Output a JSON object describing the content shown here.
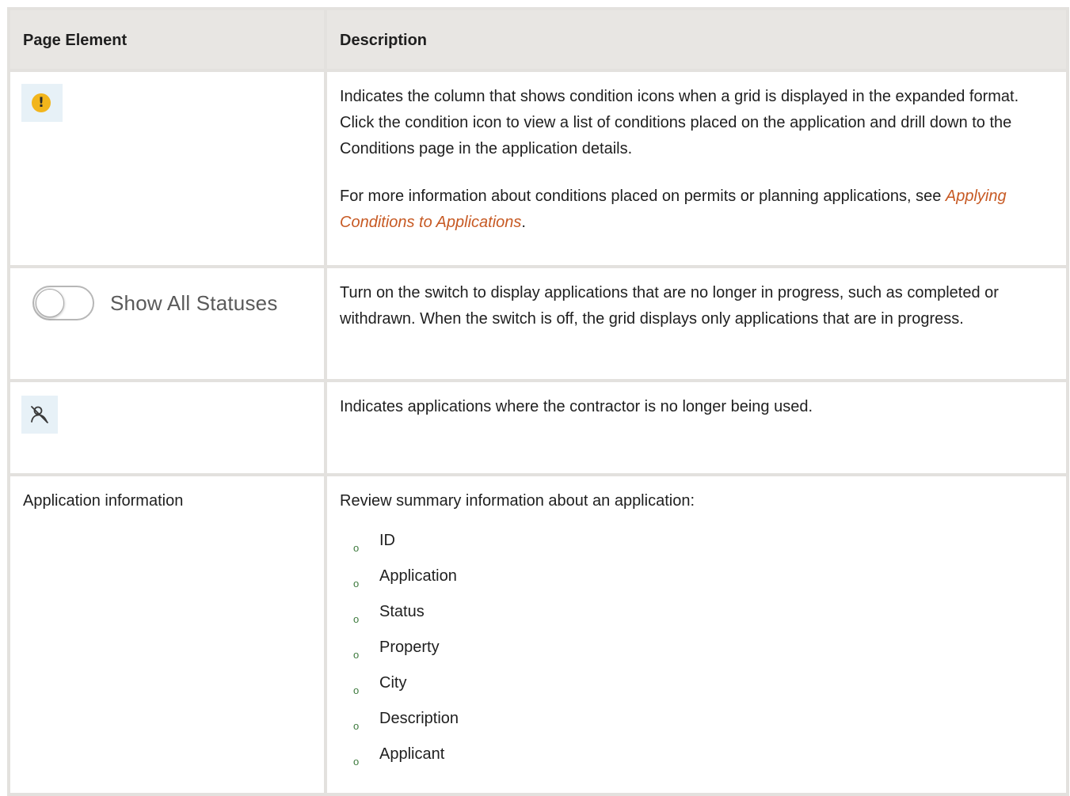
{
  "table": {
    "headers": {
      "page_element": "Page Element",
      "description": "Description"
    },
    "rows": {
      "condition": {
        "icon": "warning-icon",
        "icon_color": "#f2b51c",
        "desc_p1": "Indicates the column that shows condition icons when a grid is displayed in the expanded format. Click the condition icon to view a list of conditions placed on the application and drill down to the Conditions page in the application details.",
        "desc_p2_prefix": "For more information about conditions placed on permits or planning applications, see ",
        "desc_p2_link": "Applying Conditions to Applications",
        "desc_p2_suffix": "."
      },
      "status_toggle": {
        "toggle_label": "Show All Statuses",
        "toggle_state": "off",
        "desc": "Turn on the switch to display applications that are no longer in progress, such as completed or withdrawn. When the switch is off, the grid displays only applications that are in progress."
      },
      "contractor": {
        "icon": "contractor-removed-icon",
        "desc": "Indicates applications where the contractor is no longer being used."
      },
      "app_info": {
        "element": "Application information",
        "desc": "Review summary information about an application:",
        "items": [
          "ID",
          "Application",
          "Status",
          "Property",
          "City",
          "Description",
          "Applicant"
        ],
        "bullet_char": "o"
      }
    }
  },
  "colors": {
    "link": "#c75a24",
    "header_bg": "#e8e6e3",
    "border": "#e3e1de",
    "icon_tile_bg": "#e7f1f7"
  }
}
